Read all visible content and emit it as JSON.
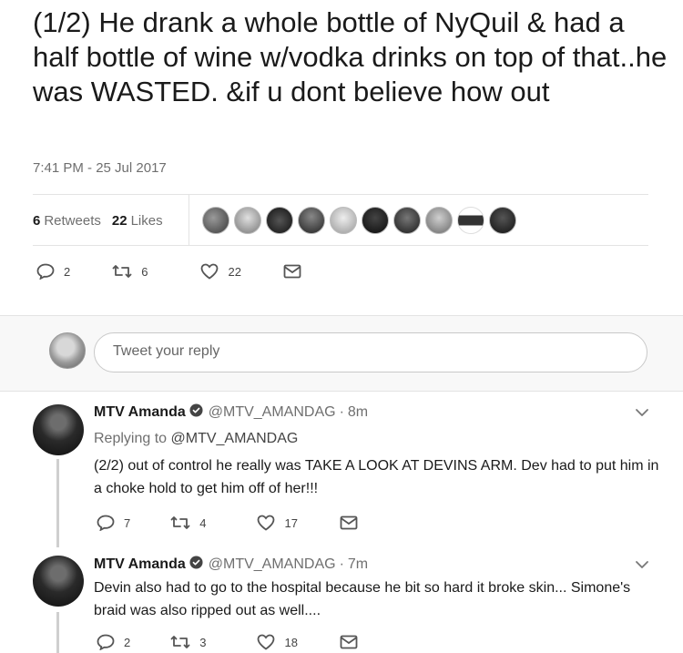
{
  "main_tweet": {
    "text": "(1/2) He drank a whole bottle of NyQuil & had a half bottle of wine w/vodka drinks on top of that..he was WASTED. &if u dont believe how out",
    "timestamp": "7:41 PM - 25 Jul 2017",
    "retweets_count": "6",
    "retweets_label": "Retweets",
    "likes_count": "22",
    "likes_label": "Likes",
    "actions": {
      "reply_count": "2",
      "retweet_count": "6",
      "like_count": "22"
    }
  },
  "reply_box": {
    "placeholder": "Tweet your reply"
  },
  "replies": [
    {
      "name": "MTV Amanda",
      "handle": "@MTV_AMANDAG",
      "separator": "·",
      "time": "8m",
      "replying_prefix": "Replying to",
      "replying_to": "@MTV_AMANDAG",
      "text": "(2/2) out of control he really was TAKE A LOOK AT DEVINS ARM. Dev had to put him in a choke hold to get him off of her!!!",
      "reply_count": "7",
      "retweet_count": "4",
      "like_count": "17"
    },
    {
      "name": "MTV Amanda",
      "handle": "@MTV_AMANDAG",
      "separator": "·",
      "time": "7m",
      "text": "Devin also had to go to the hospital because he bit so hard it broke skin... Simone's braid was also ripped out as well....",
      "reply_count": "2",
      "retweet_count": "3",
      "like_count": "18"
    }
  ],
  "icons": {
    "reply": "reply-icon",
    "retweet": "retweet-icon",
    "like": "heart-icon",
    "dm": "envelope-icon",
    "verified": "verified-badge-icon",
    "more": "chevron-down-icon"
  }
}
